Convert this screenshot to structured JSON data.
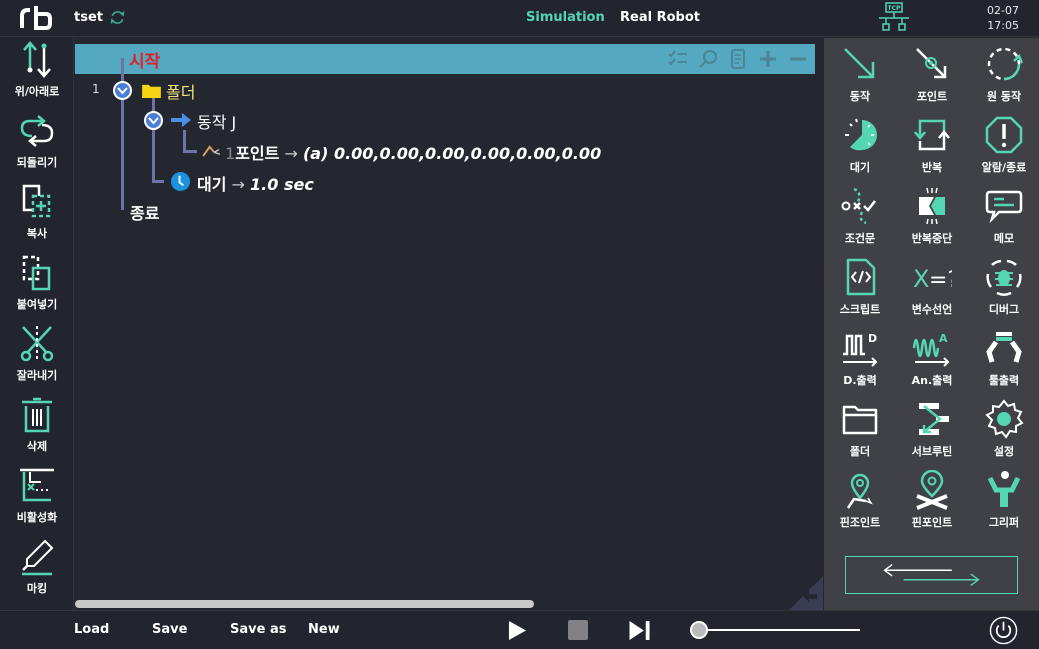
{
  "header": {
    "project_name": "tset",
    "modes": [
      "Simulation",
      "Real Robot"
    ],
    "active_mode": "Simulation",
    "tcp_label": "TCP",
    "date": "02-07",
    "time": "17:05"
  },
  "left_toolbar": {
    "items": [
      {
        "label": "위/아래로",
        "icon": "move-up-down-icon"
      },
      {
        "label": "되돌리기",
        "icon": "undo-redo-icon"
      },
      {
        "label": "복사",
        "icon": "copy-icon"
      },
      {
        "label": "붙여넣기",
        "icon": "paste-icon"
      },
      {
        "label": "잘라내기",
        "icon": "cut-icon"
      },
      {
        "label": "삭제",
        "icon": "trash-icon"
      },
      {
        "label": "비활성화",
        "icon": "disable-icon"
      },
      {
        "label": "마킹",
        "icon": "marker-icon"
      }
    ]
  },
  "program_tree": {
    "start_label": "시작",
    "end_label": "종료",
    "row_tools": [
      "checklist-icon",
      "search-icon",
      "document-icon",
      "plus-icon",
      "minus-icon"
    ],
    "nodes": [
      {
        "row_number": "1",
        "label": "폴더",
        "type": "folder"
      },
      {
        "label": "동작 J",
        "type": "move"
      },
      {
        "index": "1",
        "label": "포인트",
        "arrow": "→",
        "value": "(a) 0.00,0.00,0.00,0.00,0.00,0.00",
        "type": "point"
      },
      {
        "label": "대기",
        "arrow": "→",
        "value": "1.0 sec",
        "type": "wait"
      }
    ]
  },
  "palette": {
    "items": [
      {
        "label": "동작",
        "icon": "move-arrow-icon"
      },
      {
        "label": "포인트",
        "icon": "point-icon"
      },
      {
        "label": "원 동작",
        "icon": "circular-move-icon"
      },
      {
        "label": "대기",
        "icon": "wait-timer-icon"
      },
      {
        "label": "반복",
        "icon": "repeat-icon"
      },
      {
        "label": "알람/종료",
        "icon": "alarm-stop-icon"
      },
      {
        "label": "조건문",
        "icon": "condition-icon"
      },
      {
        "label": "반복중단",
        "icon": "break-icon"
      },
      {
        "label": "메모",
        "icon": "memo-icon"
      },
      {
        "label": "스크립트",
        "icon": "script-icon"
      },
      {
        "label": "변수선언",
        "icon": "variable-icon"
      },
      {
        "label": "디버그",
        "icon": "debug-icon"
      },
      {
        "label": "D.출력",
        "icon": "digital-out-icon"
      },
      {
        "label": "An.출력",
        "icon": "analog-out-icon"
      },
      {
        "label": "툴출력",
        "icon": "tool-out-icon"
      },
      {
        "label": "폴더",
        "icon": "folder-icon"
      },
      {
        "label": "서브루틴",
        "icon": "subroutine-icon"
      },
      {
        "label": "설정",
        "icon": "settings-icon"
      },
      {
        "label": "핀조인트",
        "icon": "pin-joint-icon"
      },
      {
        "label": "핀포인트",
        "icon": "pin-point-icon"
      },
      {
        "label": "그리퍼",
        "icon": "gripper-icon"
      }
    ]
  },
  "footer": {
    "load": "Load",
    "save": "Save",
    "save_as": "Save as",
    "new": "New",
    "speed_fraction": 0.0
  },
  "colors": {
    "accent": "#55d6b2",
    "start_row": "#55a8c1",
    "start_text": "#e0202a",
    "folder": "#f0e27a"
  }
}
